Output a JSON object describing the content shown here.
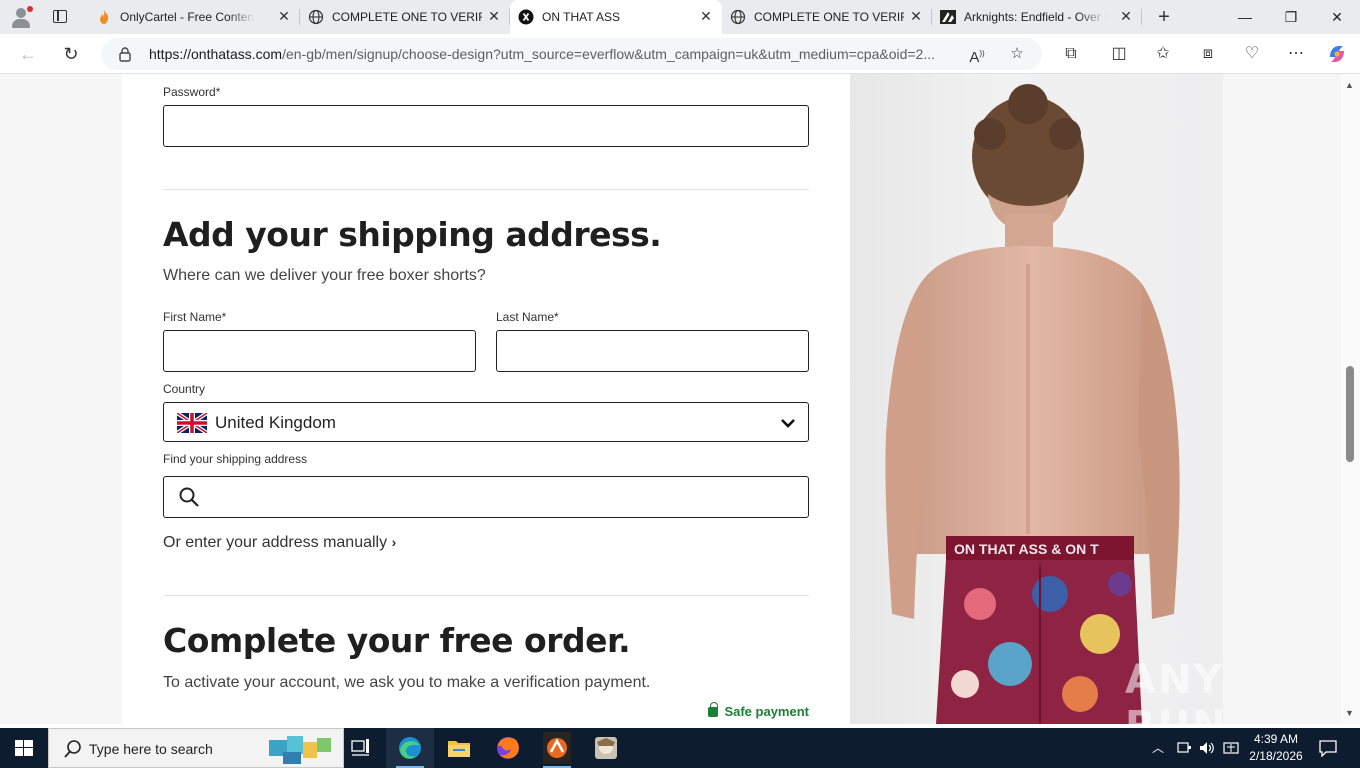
{
  "browser": {
    "tabs": [
      {
        "title": "OnlyCartel - Free Content Do",
        "favicon": "flame-favicon",
        "active": false
      },
      {
        "title": "COMPLETE ONE TO VERIFY",
        "favicon": "globe-favicon",
        "active": false
      },
      {
        "title": "ON THAT ASS",
        "favicon": "brand-favicon",
        "active": true
      },
      {
        "title": "COMPLETE ONE TO VERIFY",
        "favicon": "globe-favicon",
        "active": false
      },
      {
        "title": "Arknights: Endfield - Over th",
        "favicon": "arknights-favicon",
        "active": false
      }
    ],
    "url_host": "https://onthatass.com",
    "url_path": "/en-gb/men/signup/choose-design?utm_source=everflow&utm_campaign=uk&utm_medium=cpa&oid=2..."
  },
  "form": {
    "password_label": "Password*",
    "shipping_title": "Add your shipping address.",
    "shipping_subtitle": "Where can we deliver your free boxer shorts?",
    "first_name_label": "First Name*",
    "last_name_label": "Last Name*",
    "country_label": "Country",
    "country_value": "United Kingdom",
    "find_address_label": "Find your shipping address",
    "manual_link": "Or enter your address manually",
    "order_title": "Complete your free order.",
    "order_subtitle": "To activate your account, we ask you to make a verification payment.",
    "safe_payment": "Safe payment"
  },
  "photo": {
    "waistband_text": "ON THAT ASS & ON T"
  },
  "watermark": "ANY RUN",
  "taskbar": {
    "search_placeholder": "Type here to search",
    "time": "4:39 AM",
    "date": "2/18/2026"
  },
  "colors": {
    "accent_green": "#1a7f37",
    "taskbar": "#0d1c2e",
    "heading": "#1f1f1f"
  }
}
